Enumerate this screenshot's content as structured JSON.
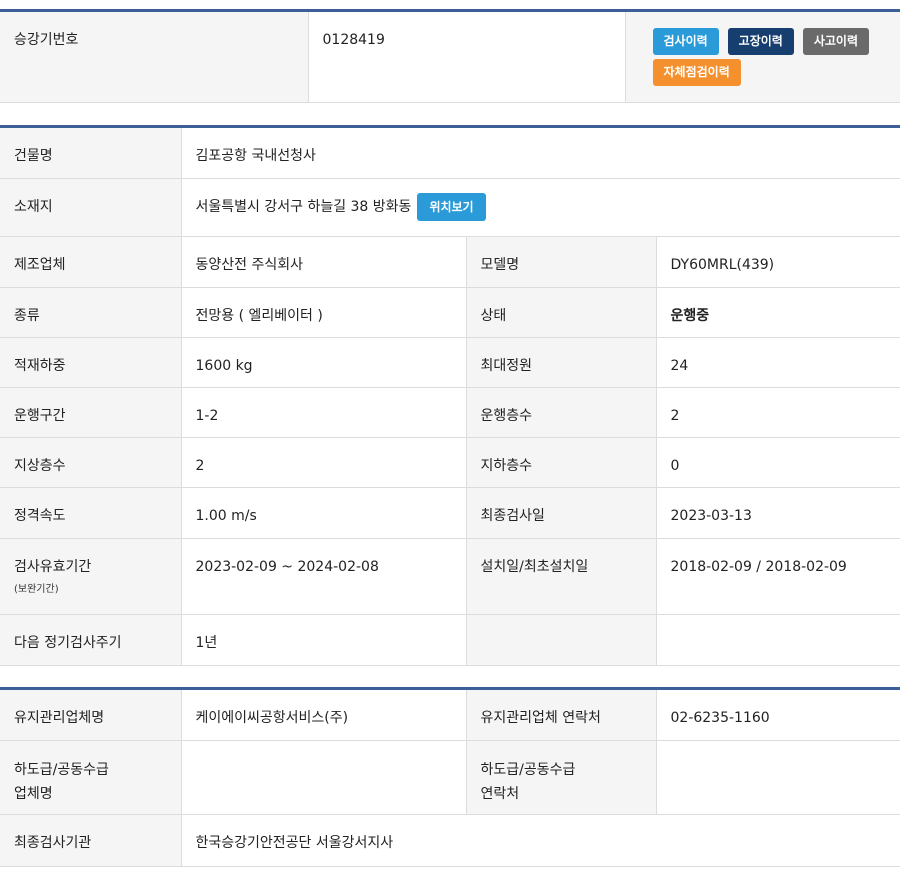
{
  "header": {
    "label": "승강기번호",
    "value": "0128419",
    "buttons": {
      "inspection": "검사이력",
      "fault": "고장이력",
      "accident": "사고이력",
      "self_check": "자체점검이력"
    }
  },
  "building": {
    "name_label": "건물명",
    "name_value": "김포공항 국내선청사",
    "address_label": "소재지",
    "address_value": "서울특별시 강서구 하늘길 38 방화동",
    "location_button": "위치보기",
    "maker_label": "제조업체",
    "maker_value": "동양산전 주식회사",
    "model_label": "모델명",
    "model_value": "DY60MRL(439)",
    "type_label": "종류",
    "type_value": "전망용 ( 엘리베이터 )",
    "status_label": "상태",
    "status_value": "운행중",
    "load_label": "적재하중",
    "load_value": "1600 kg",
    "capacity_label": "최대정원",
    "capacity_value": "24",
    "section_label": "운행구간",
    "section_value": "1-2",
    "floors_label": "운행층수",
    "floors_value": "2",
    "above_label": "지상층수",
    "above_value": "2",
    "below_label": "지하층수",
    "below_value": "0",
    "speed_label": "정격속도",
    "speed_value": "1.00 m/s",
    "last_insp_label": "최종검사일",
    "last_insp_value": "2023-03-13",
    "valid_label": "검사유효기간",
    "valid_sub": "(보완기간)",
    "valid_value": "2023-02-09 ~ 2024-02-08",
    "install_label": "설치일/최초설치일",
    "install_value": "2018-02-09 / 2018-02-09",
    "cycle_label": "다음 정기검사주기",
    "cycle_value": "1년"
  },
  "maintenance": {
    "company_label": "유지관리업체명",
    "company_value": "케이에이씨공항서비스(주)",
    "contact_label": "유지관리업체 연락처",
    "contact_value": "02-6235-1160",
    "sub_label_1": "하도급/공동수급",
    "sub_label_2": "업체명",
    "sub_contact_label_1": "하도급/공동수급",
    "sub_contact_label_2": "연락처",
    "agency_label": "최종검사기관",
    "agency_value": "한국승강기안전공단 서울강서지사"
  }
}
